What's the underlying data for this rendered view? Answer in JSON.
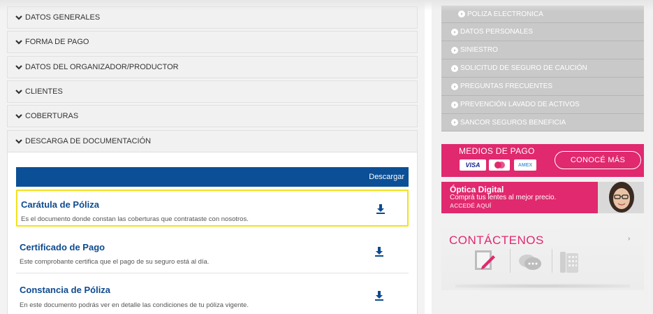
{
  "accordion": {
    "items": [
      {
        "label": "DATOS GENERALES"
      },
      {
        "label": "FORMA DE PAGO"
      },
      {
        "label": "DATOS DEL ORGANIZADOR/PRODUCTOR"
      },
      {
        "label": "CLIENTES"
      },
      {
        "label": "COBERTURAS"
      },
      {
        "label": "DESCARGA DE DOCUMENTACIÓN"
      }
    ]
  },
  "documents": {
    "header_label": "Descargar",
    "rows": [
      {
        "title": "Carátula de Póliza",
        "description": "Es el documento donde constan las coberturas que contrataste con nosotros.",
        "highlighted": true
      },
      {
        "title": "Certificado de Pago",
        "description": "Este comprobante certifica que el pago de su seguro está al día.",
        "highlighted": false
      },
      {
        "title": "Constancia de Póliza",
        "description": "En este documento podrás ver en detalle las condiciones de tu póliza vigente.",
        "highlighted": false
      }
    ]
  },
  "sidebar": {
    "menu": [
      {
        "label": "POLIZA ELECTRONICA"
      },
      {
        "label": "DATOS PERSONALES"
      },
      {
        "label": "SINIESTRO"
      },
      {
        "label": "SOLICITUD DE SEGURO DE CAUCIÓN"
      },
      {
        "label": "PREGUNTAS FRECUENTES"
      },
      {
        "label": "PREVENCIÓN LAVADO DE ACTIVOS"
      },
      {
        "label": "SANCOR SEGUROS BENEFICIA"
      }
    ],
    "payment_banner": {
      "title": "MEDIOS DE PAGO",
      "card_visa": "VISA",
      "card_amex": "AMEX",
      "cta": "CONOCÉ MÁS"
    },
    "optics_banner": {
      "title": "Óptica Digital",
      "subtitle": "Comprá tus lentes al mejor precio.",
      "cta": "ACCEDÉ AQUÍ"
    },
    "contact": {
      "title": "CONTÁCTENOS",
      "arrow": "›"
    }
  },
  "colors": {
    "accent_blue": "#0b4f96",
    "title_blue": "#0d4a8f",
    "brand_pink": "#e0296e",
    "highlight_yellow": "#f2e21a",
    "menu_gray": "#c9c9c9"
  }
}
